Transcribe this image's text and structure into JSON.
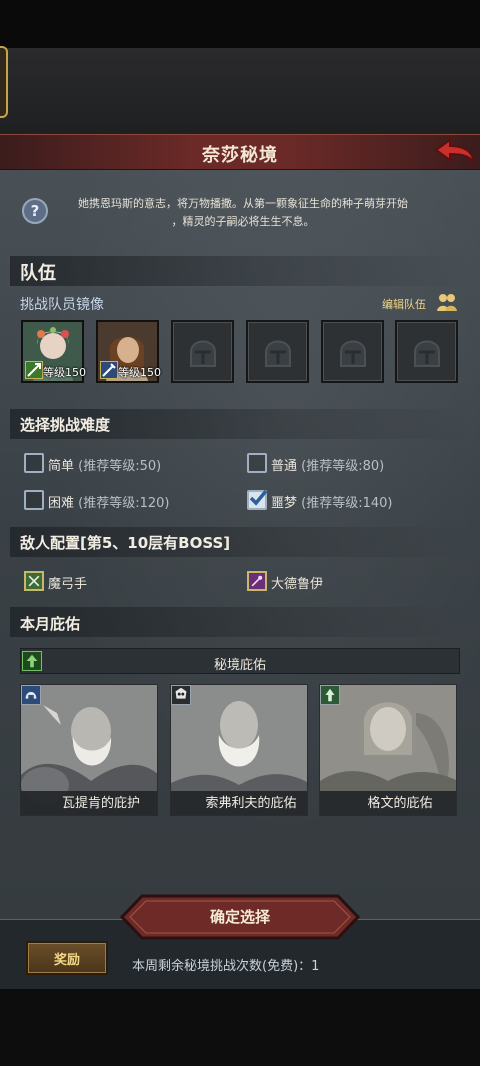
{
  "header": {
    "title": "奈莎秘境"
  },
  "description": {
    "line1": "她携恩玛斯的意志，将万物播撒。从第一颗象征生命的种子萌芽开始",
    "line2": "，精灵的子嗣必将生生不息。"
  },
  "team": {
    "section_title": "队伍",
    "subtitle": "挑战队员镜像",
    "edit_label": "编辑队伍",
    "slots": [
      {
        "level_label": "等级150"
      },
      {
        "level_label": "等级150"
      }
    ]
  },
  "difficulty": {
    "section_title": "选择挑战难度",
    "options": [
      {
        "name": "简单",
        "rec": "(推荐等级:50)",
        "checked": false
      },
      {
        "name": "普通",
        "rec": "(推荐等级:80)",
        "checked": false
      },
      {
        "name": "困难",
        "rec": "(推荐等级:120)",
        "checked": false
      },
      {
        "name": "噩梦",
        "rec": "(推荐等级:140)",
        "checked": true
      }
    ]
  },
  "enemies": {
    "section_title": "敌人配置[第5、10层有BOSS]",
    "items": [
      {
        "name": "魔弓手"
      },
      {
        "name": "大德鲁伊"
      }
    ]
  },
  "blessing": {
    "section_title": "本月庇佑",
    "bar_label": "秘境庇佑",
    "cards": [
      {
        "name": "瓦提肯的庇护"
      },
      {
        "name": "索弗利夫的庇佑"
      },
      {
        "name": "格文的庇佑"
      }
    ]
  },
  "footer": {
    "confirm_label": "确定选择",
    "reward_label": "奖励",
    "remaining_text": "本周剩余秘境挑战次数(免费)：1"
  }
}
